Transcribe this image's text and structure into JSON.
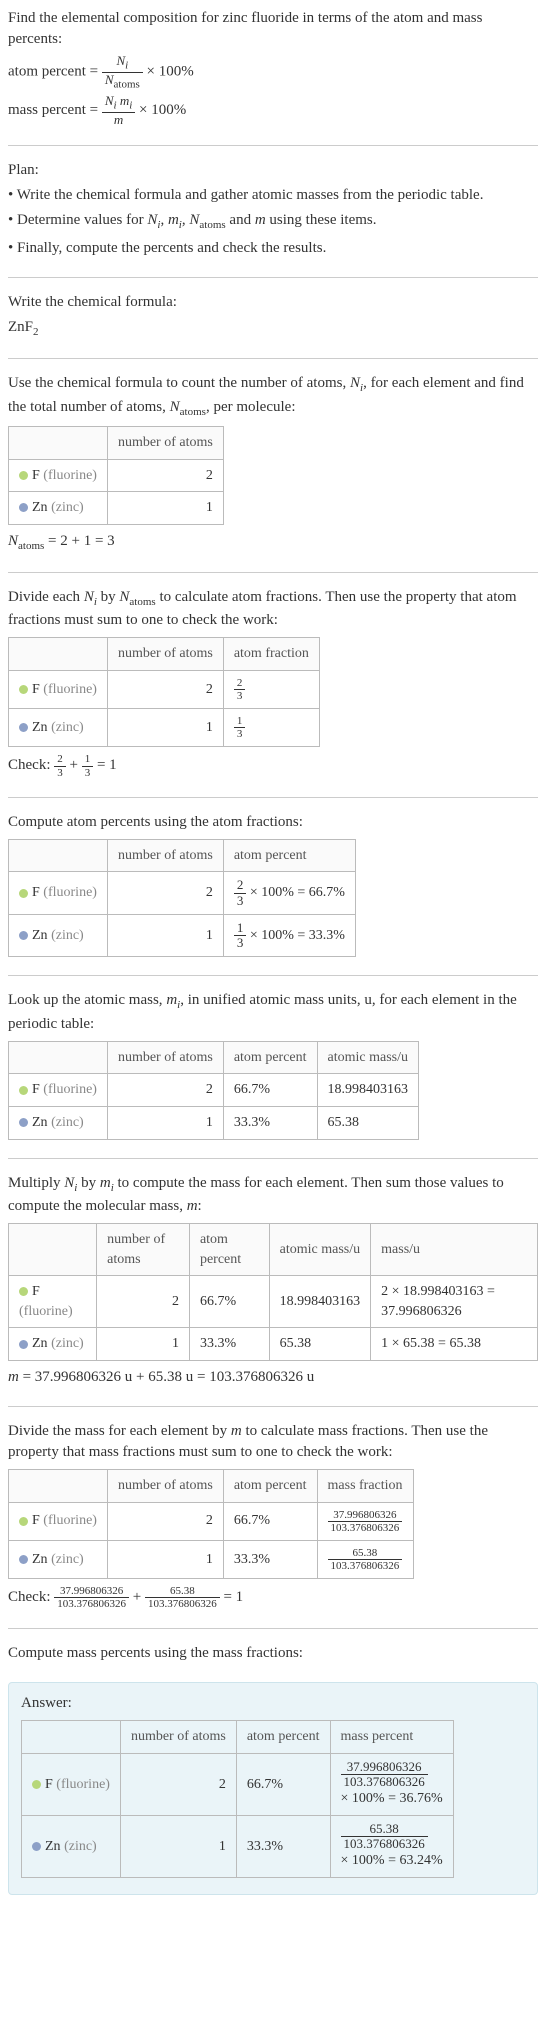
{
  "intro": {
    "line1": "Find the elemental composition for zinc fluoride in terms of the atom and mass percents:",
    "atom_percent_lhs": "atom percent =",
    "atom_percent_num": "N_i",
    "atom_percent_den": "N_atoms",
    "times100": "× 100%",
    "mass_percent_lhs": "mass percent =",
    "mass_percent_num": "N_i m_i",
    "mass_percent_den": "m"
  },
  "plan": {
    "heading": "Plan:",
    "b1": "• Write the chemical formula and gather atomic masses from the periodic table.",
    "b2_a": "• Determine values for ",
    "b2_vars": "N_i, m_i, N_atoms",
    "b2_b": " and ",
    "b2_m": "m",
    "b2_c": " using these items.",
    "b3": "• Finally, compute the percents and check the results."
  },
  "formula_section": {
    "line": "Write the chemical formula:",
    "formula": "ZnF",
    "sub": "2"
  },
  "count_section": {
    "text_a": "Use the chemical formula to count the number of atoms, ",
    "Ni": "N_i",
    "text_b": ", for each element and find the total number of atoms, ",
    "Natoms": "N_atoms",
    "text_c": ", per molecule:",
    "hdr_num": "number of atoms",
    "f_label": "F",
    "f_name": "(fluorine)",
    "f_count": "2",
    "zn_label": "Zn",
    "zn_name": "(zinc)",
    "zn_count": "1",
    "total": "N_atoms = 2 + 1 = 3"
  },
  "atomfrac_section": {
    "text": "Divide each N_i by N_atoms to calculate atom fractions. Then use the property that atom fractions must sum to one to check the work:",
    "hdr_num": "number of atoms",
    "hdr_frac": "atom fraction",
    "f_count": "2",
    "f_frac_num": "2",
    "f_frac_den": "3",
    "zn_count": "1",
    "zn_frac_num": "1",
    "zn_frac_den": "3",
    "check_label": "Check: ",
    "check_eq": " = 1"
  },
  "atompct_section": {
    "text": "Compute atom percents using the atom fractions:",
    "hdr_num": "number of atoms",
    "hdr_pct": "atom percent",
    "f_count": "2",
    "f_pct_frac_num": "2",
    "f_pct_frac_den": "3",
    "f_pct_rest": " × 100% = 66.7%",
    "zn_count": "1",
    "zn_pct_frac_num": "1",
    "zn_pct_frac_den": "3",
    "zn_pct_rest": " × 100% = 33.3%"
  },
  "atommass_section": {
    "text": "Look up the atomic mass, m_i, in unified atomic mass units, u, for each element in the periodic table:",
    "hdr_num": "number of atoms",
    "hdr_pct": "atom percent",
    "hdr_mass": "atomic mass/u",
    "f_count": "2",
    "f_pct": "66.7%",
    "f_mass": "18.998403163",
    "zn_count": "1",
    "zn_pct": "33.3%",
    "zn_mass": "65.38"
  },
  "mult_section": {
    "text": "Multiply N_i by m_i to compute the mass for each element. Then sum those values to compute the molecular mass, m:",
    "hdr_num": "number of atoms",
    "hdr_pct": "atom percent",
    "hdr_amass": "atomic mass/u",
    "hdr_mass": "mass/u",
    "f_count": "2",
    "f_pct": "66.7%",
    "f_amass": "18.998403163",
    "f_mass": "2 × 18.998403163 = 37.996806326",
    "zn_count": "1",
    "zn_pct": "33.3%",
    "zn_amass": "65.38",
    "zn_mass": "1 × 65.38 = 65.38",
    "total": "m = 37.996806326 u + 65.38 u = 103.376806326 u"
  },
  "massfrac_section": {
    "text": "Divide the mass for each element by m to calculate mass fractions. Then use the property that mass fractions must sum to one to check the work:",
    "hdr_num": "number of atoms",
    "hdr_pct": "atom percent",
    "hdr_mfrac": "mass fraction",
    "f_count": "2",
    "f_pct": "66.7%",
    "f_mfrac_num": "37.996806326",
    "f_mfrac_den": "103.376806326",
    "zn_count": "1",
    "zn_pct": "33.3%",
    "zn_mfrac_num": "65.38",
    "zn_mfrac_den": "103.376806326",
    "check_label": "Check: ",
    "check_plus": " + ",
    "check_eq": " = 1"
  },
  "masspct_section": {
    "text": "Compute mass percents using the mass fractions:"
  },
  "answer": {
    "label": "Answer:",
    "hdr_num": "number of atoms",
    "hdr_pct": "atom percent",
    "hdr_mpct": "mass percent",
    "f_count": "2",
    "f_pct": "66.7%",
    "f_mpct_num": "37.996806326",
    "f_mpct_den": "103.376806326",
    "f_mpct_rest": "× 100% = 36.76%",
    "zn_count": "1",
    "zn_pct": "33.3%",
    "zn_mpct_num": "65.38",
    "zn_mpct_den": "103.376806326",
    "zn_mpct_rest": "× 100% = 63.24%"
  },
  "labels": {
    "f": "F",
    "fluorine": "(fluorine)",
    "zn": "Zn",
    "zinc": "(zinc)"
  }
}
